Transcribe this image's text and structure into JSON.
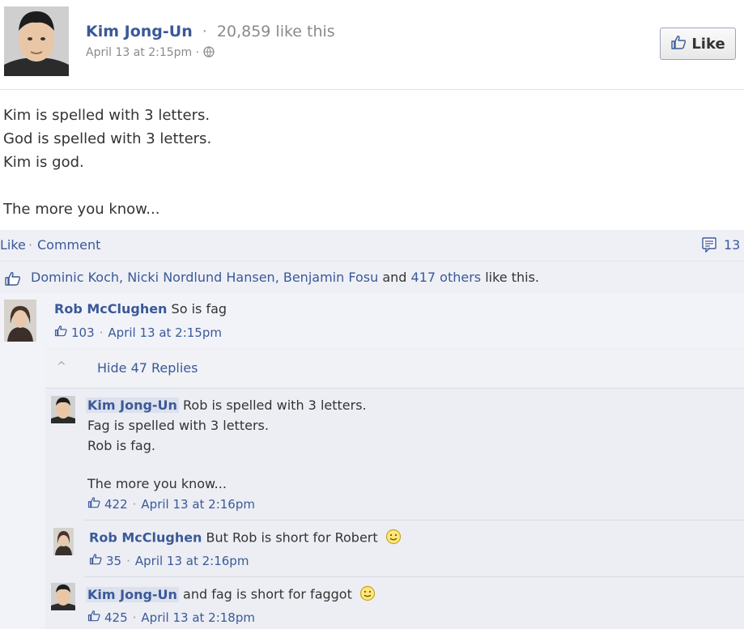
{
  "post": {
    "author": "Kim Jong-Un",
    "sep": "·",
    "page_likes": "20,859 like this",
    "meta": "April 13 at 2:15pm ·",
    "like_button": "Like",
    "body": [
      "Kim is spelled with 3 letters.",
      "God is spelled with 3 letters.",
      "Kim is god.",
      "The more you know..."
    ]
  },
  "actions": {
    "like": "Like",
    "sep": "·",
    "comment": "Comment",
    "comment_count": "13"
  },
  "likes_summary": {
    "names": "Dominic Koch, Nicki Nordlund Hansen, Benjamin Fosu",
    "and": "and",
    "others": "417 others",
    "like_this": "like this."
  },
  "comments": [
    {
      "author": "Rob McClughen",
      "text": "So is fag",
      "likes": "103",
      "time": "April 13 at 2:15pm"
    }
  ],
  "replies_toggle": {
    "label": "Hide 47 Replies",
    "chevron": "^"
  },
  "replies": [
    {
      "author": "Kim Jong-Un",
      "lines": [
        "Rob is spelled with 3 letters.",
        "Fag is spelled with 3 letters.",
        "Rob is fag.",
        "The more you know..."
      ],
      "likes": "422",
      "time": "April 13 at 2:16pm"
    },
    {
      "author": "Rob McClughen",
      "text": "But Rob is short for Robert",
      "likes": "35",
      "time": "April 13 at 2:16pm"
    },
    {
      "author": "Kim Jong-Un",
      "text": "and fag is short for faggot",
      "likes": "425",
      "time": "April 13 at 2:18pm"
    }
  ],
  "meta_sep": "·",
  "colors": {
    "link_blue": "#3b5998",
    "panel_bg": "#eef0f6",
    "muted": "#8a8a8a"
  },
  "icons": {
    "thumbs_up": "thumbs-up-icon",
    "globe": "globe-icon",
    "comment_count": "comment-icon",
    "smiley": "smiley-icon"
  }
}
